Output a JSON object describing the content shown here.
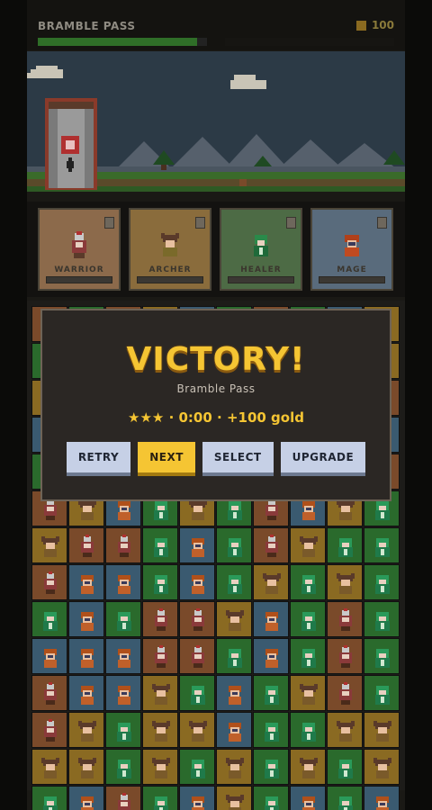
{
  "header": {
    "level_title": "BRAMBLE PASS",
    "gold": "100",
    "gold_icon": "coin-icon",
    "progress_fraction": 0.94
  },
  "scene": {
    "sky_color": "#2c3a46",
    "ground_color": "#3a6b2a"
  },
  "heroes": [
    {
      "name": "WARRIOR",
      "bg": "#8c6a4b",
      "icon": "warrior-portrait"
    },
    {
      "name": "ARCHER",
      "bg": "#8a6c3c",
      "icon": "archer-portrait"
    },
    {
      "name": "HEALER",
      "bg": "#4d6b45",
      "icon": "healer-portrait"
    },
    {
      "name": "MAGE",
      "bg": "#596b7c",
      "icon": "mage-portrait"
    }
  ],
  "modal": {
    "title": "VICTORY!",
    "subtitle": "Bramble Pass",
    "stats": "★★★ · 0:00 · +100 gold",
    "buttons": {
      "retry": "RETRY",
      "next": "NEXT",
      "select": "SELECT",
      "upgrade": "UPGRADE"
    }
  },
  "board": {
    "columns": 10,
    "rows": 13,
    "tile_colors": {
      "W": "#7a4a2a",
      "A": "#8a6a22",
      "H": "#2a6a2c",
      "M": "#3a5a70"
    },
    "grid": [
      "WHWAMHWHMA",
      "HWAMHAWMHA",
      "AMHWAWHAMW",
      "MAWHMAHWAM",
      "HMAWHWMAHW",
      "WAMHAHWMAH",
      "AWWHMHWAHH",
      "WMMHMHAHAH",
      "HMHWWAMHWH",
      "MMMWWHMHWH",
      "WMMAHMHAWH",
      "WAHAAMHHAA",
      "AAHAHAHAHA",
      "HMWHMAHMHM"
    ]
  }
}
